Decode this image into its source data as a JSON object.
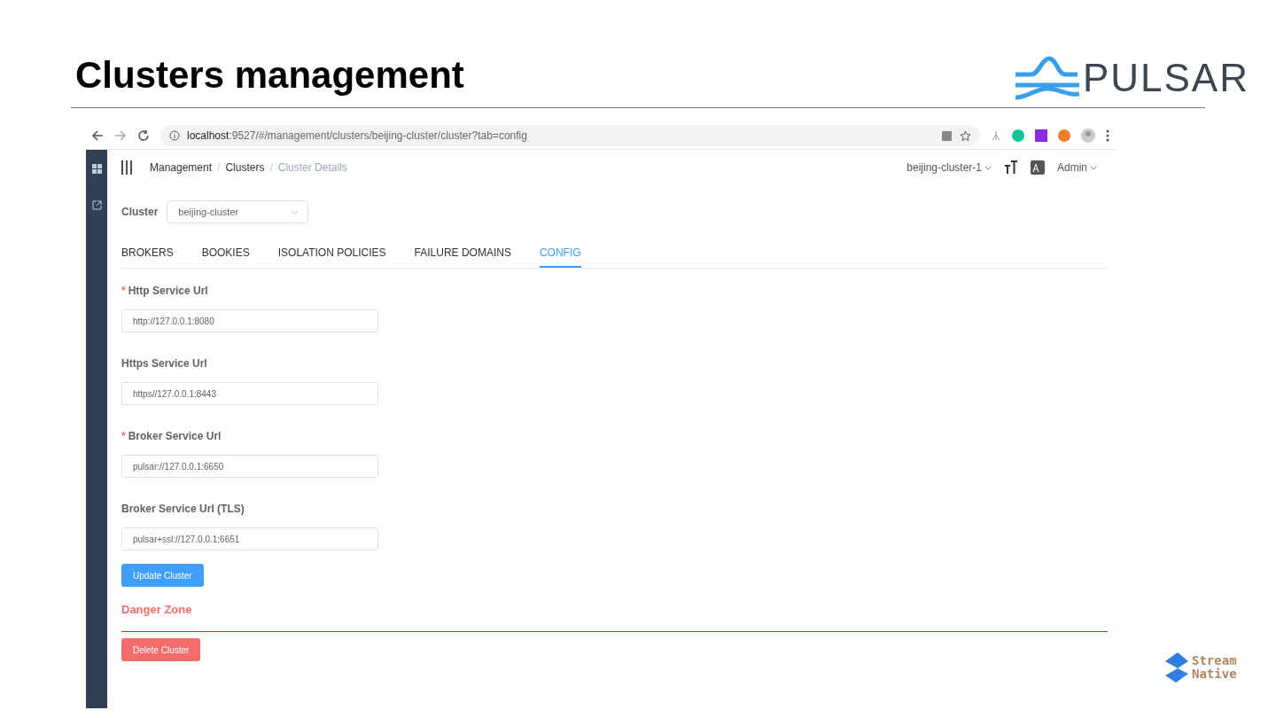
{
  "slide": {
    "title": "Clusters management",
    "logo": "PULSAR",
    "footer_logo": [
      "Stream",
      "Native"
    ]
  },
  "browser": {
    "url_host": "localhost",
    "url_rest": ":9527/#/management/clusters/beijing-cluster/cluster?tab=config"
  },
  "header": {
    "breadcrumb": [
      {
        "label": "Management",
        "current": false
      },
      {
        "label": "Clusters",
        "current": false
      },
      {
        "label": "Cluster Details",
        "current": true
      }
    ],
    "separator": "/",
    "environment": "beijing-cluster-1",
    "user": "Admin"
  },
  "cluster_select": {
    "label": "Cluster",
    "value": "beijing-cluster"
  },
  "tabs": [
    {
      "label": "BROKERS",
      "selected": false
    },
    {
      "label": "BOOKIES",
      "selected": false
    },
    {
      "label": "ISOLATION POLICIES",
      "selected": false
    },
    {
      "label": "FAILURE DOMAINS",
      "selected": false
    },
    {
      "label": "CONFIG",
      "selected": true
    }
  ],
  "required_mark": "*",
  "fields": [
    {
      "label": "Http Service Url",
      "required": true,
      "value": "http://127.0.0.1:8080"
    },
    {
      "label": "Https Service Url",
      "required": false,
      "value": "https//127.0.0.1:8443"
    },
    {
      "label": "Broker Service Url",
      "required": true,
      "value": "pulsar://127.0.0.1:6650"
    },
    {
      "label": "Broker Service Url (TLS)",
      "required": false,
      "value": "pulsar+ssl://127.0.0.1:6651"
    }
  ],
  "update_button": "Update Cluster",
  "danger_zone": {
    "title": "Danger Zone",
    "button": "Delete Cluster"
  }
}
